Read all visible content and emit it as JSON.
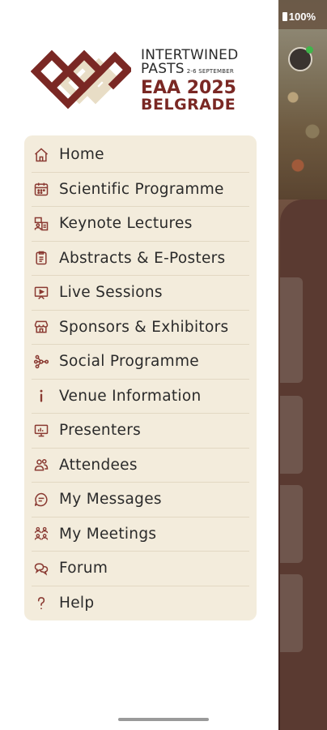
{
  "status_bar": {
    "battery": "100%"
  },
  "logo": {
    "line1": "INTERTWINED",
    "line2": "PASTS",
    "dates": "2-6 SEPTEMBER",
    "event": "EAA 2025",
    "city": "BELGRADE"
  },
  "menu": [
    {
      "label": "Home",
      "icon": "home-icon"
    },
    {
      "label": "Scientific Programme",
      "icon": "calendar-icon"
    },
    {
      "label": "Keynote Lectures",
      "icon": "lecture-icon"
    },
    {
      "label": "Abstracts & E-Posters",
      "icon": "document-icon"
    },
    {
      "label": "Live Sessions",
      "icon": "video-icon"
    },
    {
      "label": "Sponsors & Exhibitors",
      "icon": "store-icon"
    },
    {
      "label": "Social Programme",
      "icon": "network-icon"
    },
    {
      "label": "Venue Information",
      "icon": "info-icon"
    },
    {
      "label": "Presenters",
      "icon": "presentation-icon"
    },
    {
      "label": "Attendees",
      "icon": "people-icon"
    },
    {
      "label": "My Messages",
      "icon": "message-icon"
    },
    {
      "label": "My Meetings",
      "icon": "meeting-icon"
    },
    {
      "label": "Forum",
      "icon": "forum-icon"
    },
    {
      "label": "Help",
      "icon": "help-icon"
    }
  ],
  "colors": {
    "accent": "#7a2824",
    "menu_bg": "#f3ecdc",
    "knot_light": "#e8ddc6"
  }
}
